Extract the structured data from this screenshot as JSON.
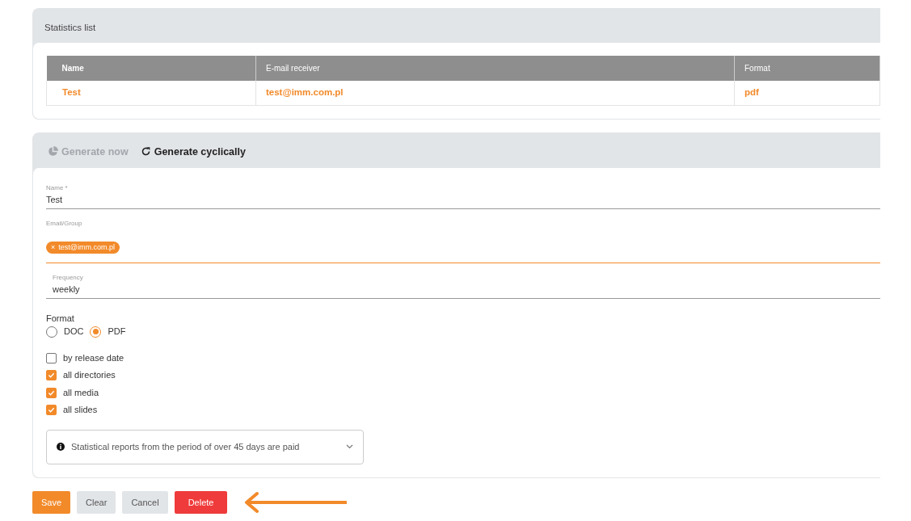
{
  "statistics_list": {
    "title": "Statistics list",
    "table": {
      "columns": [
        "Name",
        "E-mail receiver",
        "Format"
      ],
      "rows": [
        [
          "Test",
          "test@imm.com.pl",
          "pdf"
        ]
      ]
    }
  },
  "tabs": [
    {
      "label": "Generate now",
      "selected": false,
      "disabled": true
    },
    {
      "label": "Generate cyclically",
      "selected": true,
      "disabled": false
    }
  ],
  "form": {
    "name": {
      "label": "Name *",
      "value": "Test"
    },
    "email": {
      "label": "Email/Group",
      "focused": true,
      "tags": [
        {
          "remove": "×",
          "label": "test@imm.com.pl"
        }
      ]
    },
    "frequency": {
      "label": "Frequency",
      "value": "weekly"
    },
    "format": {
      "label": "Format",
      "options": [
        {
          "label": "DOC",
          "selected": false
        },
        {
          "label": "PDF",
          "selected": true
        }
      ]
    },
    "checkboxes": [
      {
        "label": "by release date",
        "checked": false
      },
      {
        "label": "all directories",
        "checked": true
      },
      {
        "label": "all media",
        "checked": true
      },
      {
        "label": "all slides",
        "checked": true
      }
    ],
    "notice": {
      "text": "Statistical reports from the period of over 45 days are paid"
    }
  },
  "buttons": [
    {
      "label": "Save",
      "kind": "primary"
    },
    {
      "label": "Clear",
      "kind": "secondary"
    },
    {
      "label": "Cancel",
      "kind": "secondary"
    },
    {
      "label": "Delete",
      "kind": "danger"
    }
  ]
}
